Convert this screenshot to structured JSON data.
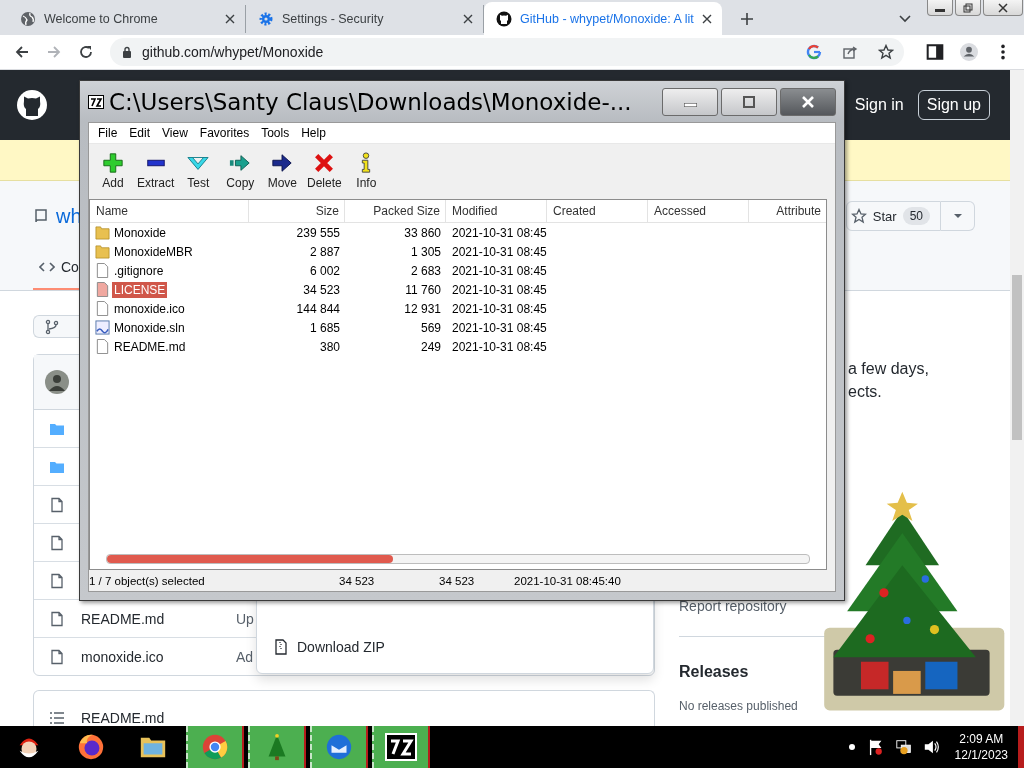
{
  "browser": {
    "tabs": [
      {
        "title": "Welcome to Chrome",
        "selected": false
      },
      {
        "title": "Settings - Security",
        "selected": false
      },
      {
        "title": "GitHub - whypet/Monoxide: A lit",
        "selected": true
      }
    ],
    "url": "github.com/whypet/Monoxide"
  },
  "github": {
    "sign_in": "Sign in",
    "sign_up": "Sign up",
    "repo_name": "wh",
    "star_label": "Star",
    "star_count": "50",
    "tab": "Co",
    "file_rows": [
      {
        "kind": "folder"
      },
      {
        "kind": "folder"
      },
      {
        "kind": "file"
      },
      {
        "kind": "file"
      },
      {
        "kind": "file"
      },
      {
        "kind": "file",
        "name": "README.md",
        "message": "Up"
      },
      {
        "kind": "file",
        "name": "monoxide.ico",
        "message": "Ad"
      }
    ],
    "download_zip": "Download ZIP",
    "about_lines": [
      "a few days,",
      "ects."
    ],
    "report": "Report repository",
    "releases_title": "Releases",
    "releases_note": "No releases published",
    "readme_title": "README.md"
  },
  "archiver": {
    "title": "C:\\Users\\Santy Claus\\Downloads\\Monoxide-...",
    "menu": [
      "File",
      "Edit",
      "View",
      "Favorites",
      "Tools",
      "Help"
    ],
    "toolbar": [
      {
        "label": "Add",
        "kind": "add"
      },
      {
        "label": "Extract",
        "kind": "extract"
      },
      {
        "label": "Test",
        "kind": "test"
      },
      {
        "label": "Copy",
        "kind": "copy"
      },
      {
        "label": "Move",
        "kind": "move"
      },
      {
        "label": "Delete",
        "kind": "delete"
      },
      {
        "label": "Info",
        "kind": "info"
      }
    ],
    "columns": [
      "Name",
      "Size",
      "Packed Size",
      "Modified",
      "Created",
      "Accessed",
      "Attribute"
    ],
    "rows": [
      {
        "kind": "folder",
        "name": "Monoxide",
        "size": "239 555",
        "packed": "33 860",
        "modified": "2021-10-31 08:45",
        "selected": false
      },
      {
        "kind": "folder",
        "name": "MonoxideMBR",
        "size": "2 887",
        "packed": "1 305",
        "modified": "2021-10-31 08:45",
        "selected": false
      },
      {
        "kind": "file",
        "name": ".gitignore",
        "size": "6 002",
        "packed": "2 683",
        "modified": "2021-10-31 08:45",
        "selected": false
      },
      {
        "kind": "file",
        "name": "LICENSE",
        "size": "34 523",
        "packed": "11 760",
        "modified": "2021-10-31 08:45",
        "selected": true
      },
      {
        "kind": "file",
        "name": "monoxide.ico",
        "size": "144 844",
        "packed": "12 931",
        "modified": "2021-10-31 08:45",
        "selected": false
      },
      {
        "kind": "solution",
        "name": "Monoxide.sln",
        "size": "1 685",
        "packed": "569",
        "modified": "2021-10-31 08:45",
        "selected": false
      },
      {
        "kind": "file",
        "name": "README.md",
        "size": "380",
        "packed": "249",
        "modified": "2021-10-31 08:45",
        "selected": false
      }
    ],
    "status": [
      "1 / 7 object(s) selected",
      "34 523",
      "34 523",
      "2021-10-31 08:45:40"
    ]
  },
  "taskbar": {
    "apps": [
      {
        "kind": "santa",
        "active": false
      },
      {
        "kind": "firefox",
        "active": false
      },
      {
        "kind": "explorer",
        "active": false
      },
      {
        "kind": "chrome",
        "active": true
      },
      {
        "kind": "tree",
        "active": true
      },
      {
        "kind": "thunderbird",
        "active": true
      },
      {
        "kind": "sevenzip",
        "active": true
      }
    ],
    "time": "2:09 AM",
    "date": "12/1/2023"
  }
}
